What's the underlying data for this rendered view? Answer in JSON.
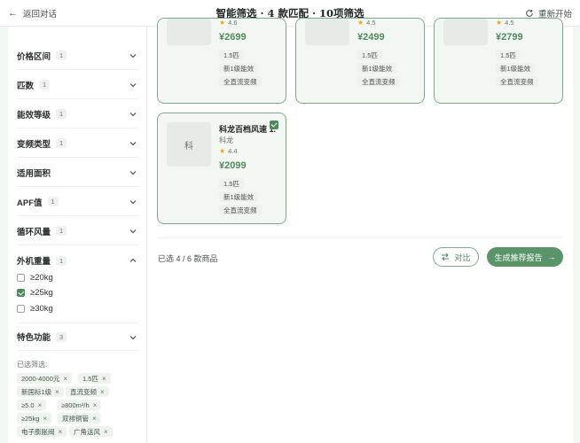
{
  "header": {
    "back_label": "返回对话",
    "title": "智能筛选 · 4 款匹配 · 10项筛选",
    "restart_label": "重新开始"
  },
  "filters": [
    {
      "label": "价格区间",
      "count": "1"
    },
    {
      "label": "匹数",
      "count": "1"
    },
    {
      "label": "能效等级",
      "count": "1"
    },
    {
      "label": "变频类型",
      "count": "1"
    },
    {
      "label": "适用面积",
      "count": ""
    },
    {
      "label": "APF值",
      "count": "1"
    },
    {
      "label": "循环风量",
      "count": "1"
    },
    {
      "label": "外机重量",
      "count": "1"
    },
    {
      "label": "特色功能",
      "count": "3"
    }
  ],
  "weight_options": [
    {
      "label": "≥20kg",
      "checked": false
    },
    {
      "label": "≥25kg",
      "checked": true
    },
    {
      "label": "≥30kg",
      "checked": false
    }
  ],
  "selected": {
    "heading": "已选筛选:",
    "chips": [
      "2000-4000元",
      "1.5匹",
      "新国标1级",
      "直流变频",
      "≥5.0",
      "≥800m³/h",
      "≥25kg",
      "双排铜管",
      "电子膨胀阀",
      "广角送风"
    ]
  },
  "products": [
    {
      "thumb": "",
      "name": "",
      "brand": "",
      "rating": "4.6",
      "price": "¥2699",
      "tags": [
        "1.5匹",
        "新1级能效",
        "全直流变频"
      ]
    },
    {
      "thumb": "",
      "name": "",
      "brand": "",
      "rating": "4.5",
      "price": "¥2499",
      "tags": [
        "1.5匹",
        "新1级能效",
        "全直流变频"
      ]
    },
    {
      "thumb": "",
      "name": "",
      "brand": "",
      "rating": "4.5",
      "price": "¥2799",
      "tags": [
        "1.5匹",
        "新1级能效",
        "全直流变频"
      ]
    },
    {
      "thumb": "科",
      "name": "科龙百档风速 1.",
      "brand": "科龙",
      "rating": "4.4",
      "price": "¥2099",
      "tags": [
        "1.5匹",
        "新1级能效",
        "全直流变频"
      ]
    }
  ],
  "footer": {
    "selected_count": "已选 4 / 6 款商品",
    "compare_label": "对比",
    "generate_label": "生成推荐报告"
  },
  "colors": {
    "accent": "#4f8a5e",
    "card_border": "#7fa98a",
    "star": "#e6a817"
  }
}
